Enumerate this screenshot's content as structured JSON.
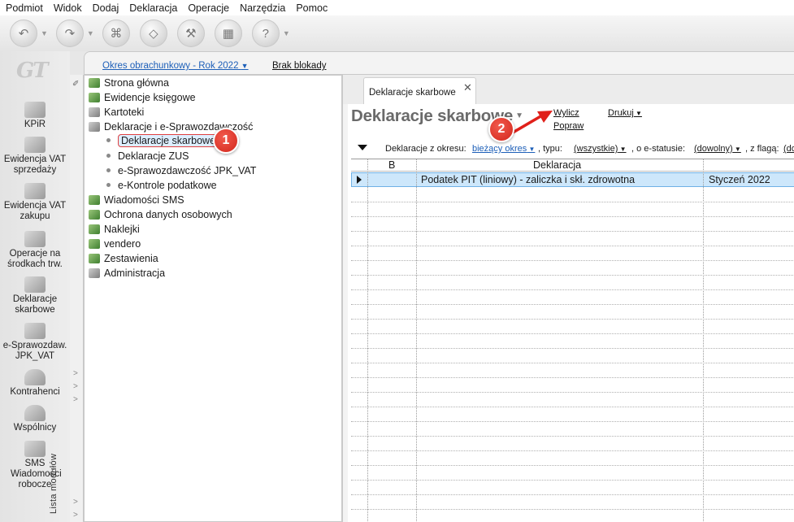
{
  "menu": [
    "Podmiot",
    "Widok",
    "Dodaj",
    "Deklaracja",
    "Operacje",
    "Narzędzia",
    "Pomoc"
  ],
  "toolbar": {
    "buttons": [
      "back-icon",
      "forward-icon",
      "stamp-icon",
      "eraser-icon",
      "tools-icon",
      "calculator-icon",
      "help-icon"
    ]
  },
  "leftnav": {
    "logo": "GT",
    "items": [
      {
        "label": "KPiR",
        "icon": "book-icon"
      },
      {
        "label": "Ewidencja VAT sprzedaży",
        "icon": "coins-icon"
      },
      {
        "label": "Ewidencja VAT zakupu",
        "icon": "coins-icon"
      },
      {
        "label": "Operacje na środkach trw.",
        "icon": "machine-icon"
      },
      {
        "label": "Deklaracje skarbowe",
        "icon": "form-icon"
      },
      {
        "label": "e-Sprawozdaw. JPK_VAT",
        "icon": "jpk-icon"
      },
      {
        "label": "Kontrahenci",
        "icon": "person-icon"
      },
      {
        "label": "Wspólnicy",
        "icon": "people-icon"
      },
      {
        "label": "SMS Wiadomości robocze",
        "icon": "sms-icon"
      }
    ],
    "modules_label": "Lista modułów"
  },
  "okres": {
    "label": "Okres obrachunkowy - Rok 2022",
    "blokada": "Brak blokady"
  },
  "tree": [
    {
      "label": "Strona główna",
      "level": 0
    },
    {
      "label": "Ewidencje księgowe",
      "level": 0
    },
    {
      "label": "Kartoteki",
      "level": 0
    },
    {
      "label": "Deklaracje i e-Sprawozdawczość",
      "level": 0
    },
    {
      "label": "Deklaracje skarbowe",
      "level": 1,
      "selected": true
    },
    {
      "label": "Deklaracje ZUS",
      "level": 1
    },
    {
      "label": "e-Sprawozdawczość JPK_VAT",
      "level": 1
    },
    {
      "label": "e-Kontrole podatkowe",
      "level": 1
    },
    {
      "label": "Wiadomości SMS",
      "level": 0
    },
    {
      "label": "Ochrona danych osobowych",
      "level": 0
    },
    {
      "label": "Naklejki",
      "level": 0
    },
    {
      "label": "vendero",
      "level": 0
    },
    {
      "label": "Zestawienia",
      "level": 0
    },
    {
      "label": "Administracja",
      "level": 0
    }
  ],
  "badges": {
    "one": "1",
    "two": "2"
  },
  "content": {
    "tab_label": "Deklaracje skarbowe",
    "title": "Deklaracje skarbowe",
    "actions": {
      "wylicz": "Wylicz",
      "popraw": "Popraw",
      "drukuj": "Drukuj"
    },
    "filters": {
      "okres_label": "Deklaracje z okresu:",
      "okres_value": "bieżący okres",
      "typ_label": ", typu:",
      "typ_value": "(wszystkie)",
      "status_label": ", o e-statusie:",
      "status_value": "(dowolny)",
      "flaga_label": ", z flagą:",
      "flaga_value": "(do"
    },
    "columns": [
      "B",
      "Deklaracja"
    ],
    "rows": [
      {
        "deklaracja": "Podatek PIT (liniowy) - zaliczka i skł. zdrowotna",
        "okres": "Styczeń 2022"
      }
    ]
  },
  "colors": {
    "accent_red": "#d2261b",
    "selection": "#cde7fb",
    "link": "#1d5fb8"
  }
}
